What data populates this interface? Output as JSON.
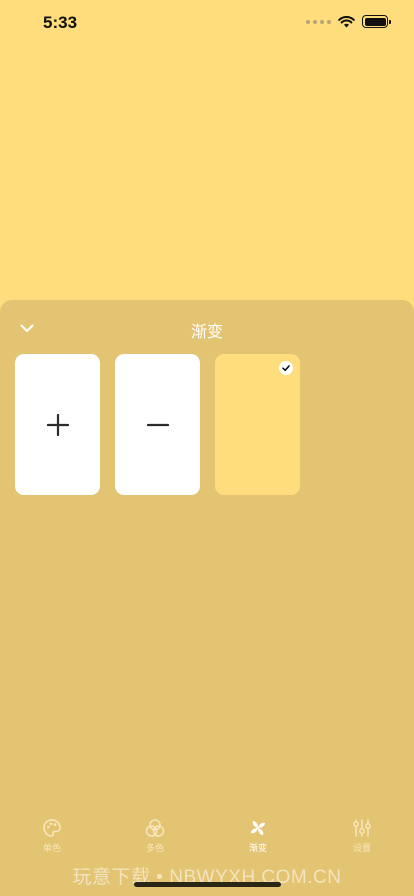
{
  "status_bar": {
    "time": "5:33"
  },
  "sheet": {
    "title": "渐变"
  },
  "cards": [
    {
      "type": "add",
      "icon": "plus-icon"
    },
    {
      "type": "remove",
      "icon": "minus-icon"
    },
    {
      "type": "swatch",
      "color": "#FFDC7C",
      "selected": true
    }
  ],
  "tabs": [
    {
      "label": "单色",
      "icon": "palette-icon",
      "active": false
    },
    {
      "label": "多色",
      "icon": "overlap-circles-icon",
      "active": false
    },
    {
      "label": "渐变",
      "icon": "pinwheel-icon",
      "active": true
    },
    {
      "label": "设置",
      "icon": "sliders-icon",
      "active": false
    }
  ],
  "watermark": "玩意下载 • NBWYXH.COM.CN",
  "colors": {
    "background": "#FFDC7C",
    "sheet": "#E3C472"
  }
}
